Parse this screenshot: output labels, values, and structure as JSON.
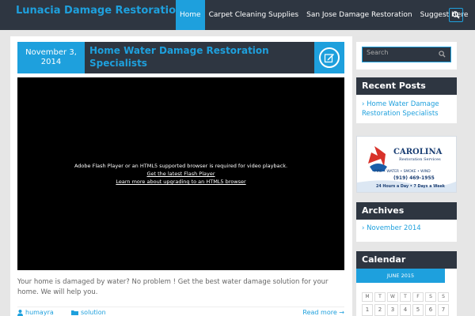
{
  "header": {
    "site_title": "Lunacia Damage Restoration",
    "nav": [
      "Home",
      "Carpet Cleaning Supplies",
      "San Jose Damage Restoration",
      "Suggest Here"
    ],
    "search_icon": "search-icon"
  },
  "post": {
    "date_line1": "November 3,",
    "date_line2": "2014",
    "title": "Home Water Damage Restoration Specialists",
    "edit_icon": "edit-icon",
    "video": {
      "message": "Adobe Flash Player or an HTML5 supported browser is required for video playback.",
      "link1": "Get the latest Flash Player",
      "link2": "Learn more about upgrading to an HTML5 browser"
    },
    "excerpt": "Your home is damaged by water? No problem ! Get the best water damage solution for your home. We will help you.",
    "author": "humayra",
    "category": "solution",
    "read_more": "Read more →"
  },
  "sidebar": {
    "search_placeholder": "Search",
    "recent_title": "Recent Posts",
    "recent_item": "Home Water Damage Restoration Specialists",
    "ad": {
      "name_line1": "CAROLINA",
      "name_line2": "Restoration Services",
      "services": "FIRE • WATER • SMOKE • WIND",
      "phone": "(919) 469-1955",
      "hours": "24 Hours a Day • 7 Days a Week"
    },
    "archives_title": "Archives",
    "archive_item": "November 2014",
    "calendar_title": "Calendar",
    "calendar_month": "JUNE 2015",
    "weekdays": [
      "M",
      "T",
      "W",
      "T",
      "F",
      "S",
      "S"
    ],
    "first_row": [
      "1",
      "2",
      "3",
      "4",
      "5",
      "6",
      "7"
    ]
  },
  "colors": {
    "accent": "#1ea0dd",
    "dark": "#2e3641",
    "background": "#e6e6e6"
  }
}
